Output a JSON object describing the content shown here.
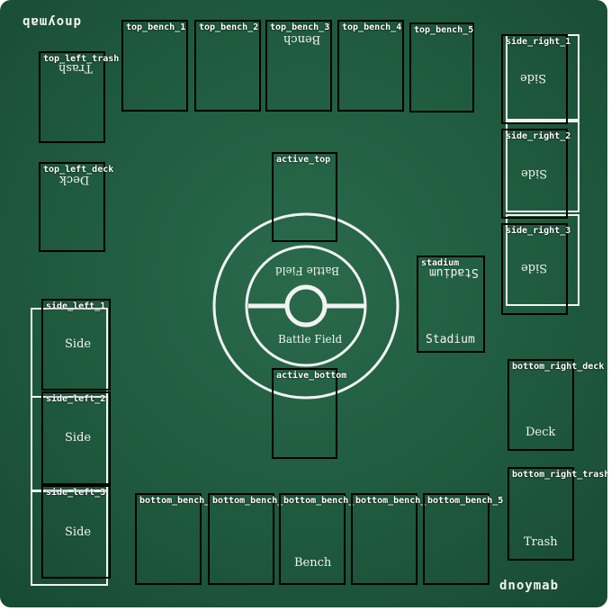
{
  "mat": {
    "brand_top": "dnoymab",
    "brand_bottom": "dnoymab",
    "battle_field_top": "Battle Field",
    "battle_field_bottom": "Battle Field",
    "bench_top": "Bench",
    "bench_bottom": "Bench",
    "stadium_top": "Stadium",
    "stadium_bottom": "Stadium",
    "trash_top": "Trash",
    "trash_bottom": "Trash",
    "deck_top": "Deck",
    "deck_bottom": "Deck",
    "side_top": "Side",
    "side_bottom": "Side"
  },
  "zones": {
    "top_left_trash": "top_left_trash",
    "top_left_deck": "top_left_deck",
    "top_bench_1": "top_bench_1",
    "top_bench_2": "top_bench_2",
    "top_bench_3": "top_bench_3",
    "top_bench_4": "top_bench_4",
    "top_bench_5": "top_bench_5",
    "side_right_1": "side_right_1",
    "side_right_2": "side_right_2",
    "side_right_3": "side_right_3",
    "active_top": "active_top",
    "active_bottom": "active_bottom",
    "stadium": "stadium",
    "side_left_1": "side_left_1",
    "side_left_2": "side_left_2",
    "side_left_3": "side_left_3",
    "bottom_bench_1": "bottom_bench_",
    "bottom_bench_2": "bottom_bench_",
    "bottom_bench_3": "bottom_bench_",
    "bottom_bench_4": "bottom_bench_",
    "bottom_bench_5": "bottom_bench_5",
    "bottom_right_deck": "bottom_right_deck",
    "bottom_right_trash": "bottom_right_trash"
  }
}
